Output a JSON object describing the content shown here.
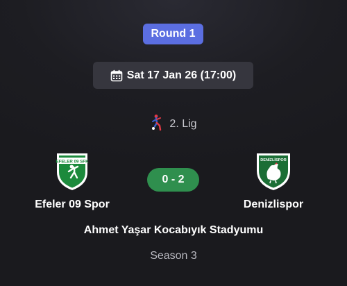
{
  "round_label": "Round 1",
  "datetime": "Sat 17 Jan 26 (17:00)",
  "datetime_icon": "calendar-icon",
  "league": {
    "name": "2. Lig",
    "icon": "league-logo-icon"
  },
  "home_team": {
    "name": "Efeler 09 Spor",
    "crest_text": "EFELER 09 SFK",
    "crest_color": "#1c8a3c"
  },
  "away_team": {
    "name": "Denizlispor",
    "crest_text": "DENİZLİSPOR",
    "crest_color": "#1b6e35"
  },
  "score": "0 - 2",
  "stadium": "Ahmet Yaşar Kocabıyık Stadyumu",
  "season": "Season 3",
  "colors": {
    "background": "#1d1d22",
    "round_badge": "#5b6ee1",
    "date_pill": "#36363e",
    "score_pill": "#2f8f4e"
  }
}
